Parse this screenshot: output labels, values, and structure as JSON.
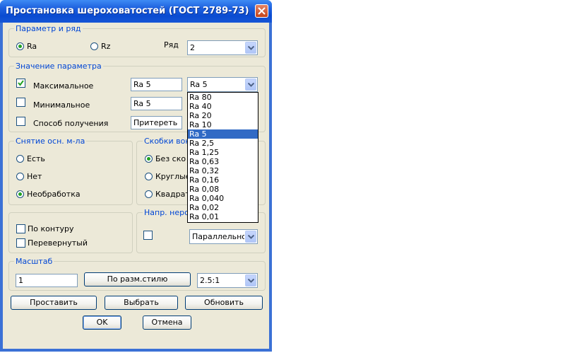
{
  "window": {
    "title": "Простановка шероховатостей (ГОСТ 2789-73)"
  },
  "param_group": {
    "title": "Параметр и ряд",
    "radio_ra": "Ra",
    "radio_rz": "Rz",
    "row_label": "Ряд",
    "row_value": "2"
  },
  "value_group": {
    "title": "Значение параметра",
    "max_label": "Максимальное",
    "max_checked": true,
    "max_value": "Ra 5",
    "min_label": "Минимальное",
    "min_checked": false,
    "min_value": "Ra 5",
    "method_label": "Способ получения",
    "method_checked": false,
    "method_value": "Притереть",
    "combo_value": "Ra 5"
  },
  "dropdown": {
    "selected": "Ra 5",
    "options": [
      "Ra 80",
      "Ra 40",
      "Ra 20",
      "Ra 10",
      "Ra 5",
      "Ra 2,5",
      "Ra 1,25",
      "Ra 0,63",
      "Ra 0,32",
      "Ra 0,16",
      "Ra 0,08",
      "Ra 0,040",
      "Ra 0,02",
      "Ra 0,01"
    ]
  },
  "removal_group": {
    "title": "Снятие осн. м-ла",
    "options": [
      "Есть",
      "Нет",
      "Необработка"
    ],
    "selected": "Необработка"
  },
  "brackets_group": {
    "title": "Скобки вок",
    "options": [
      "Без ско",
      "Круглые",
      "Квадрат"
    ],
    "selected": "Без ско"
  },
  "contour_group": {
    "by_contour": "По контуру",
    "inverted": "Перевернутый"
  },
  "direction_group": {
    "title": "Напр. неров",
    "value": "Параллельное"
  },
  "scale_group": {
    "title": "Масштаб",
    "value": "1",
    "style_button": "По разм.стилю",
    "ratio": "2.5:1"
  },
  "buttons": {
    "place": "Проставить",
    "select": "Выбрать",
    "update": "Обновить",
    "ok": "OK",
    "cancel": "Отмена"
  }
}
